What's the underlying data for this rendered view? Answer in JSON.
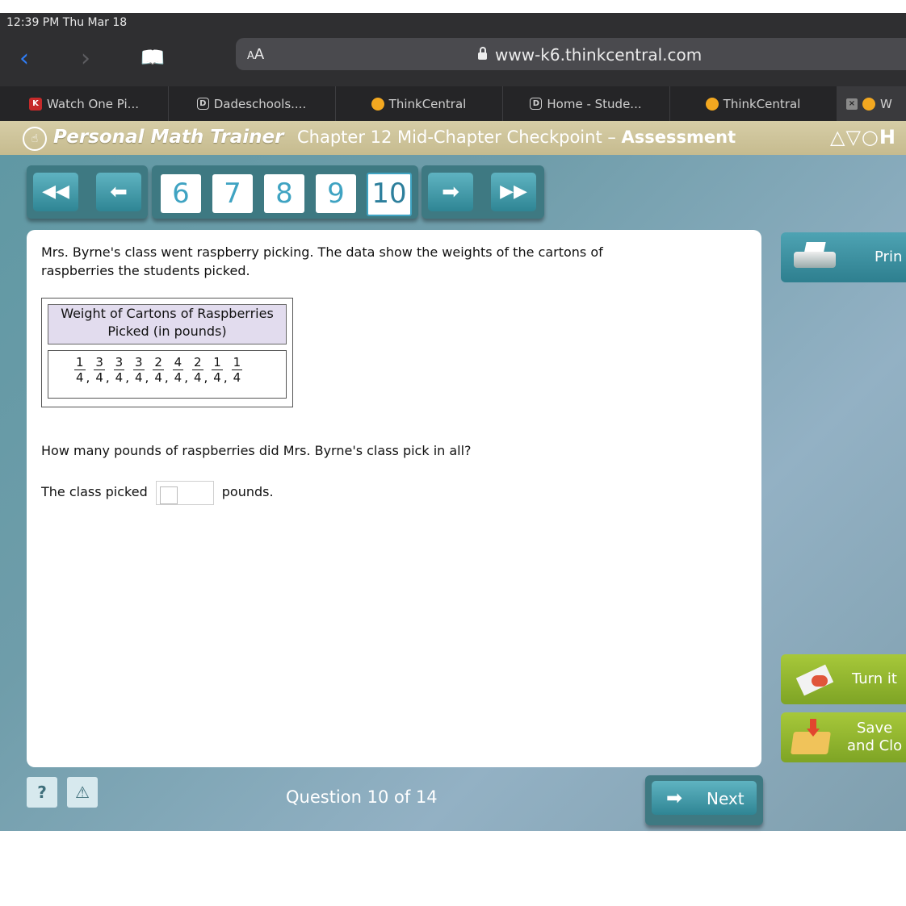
{
  "status_bar": {
    "time": "12:39 PM   Thu Mar 18"
  },
  "browser": {
    "back_glyph": "‹",
    "forward_glyph": "›",
    "bookmarks_glyph": "📖",
    "text_size_small": "A",
    "text_size_large": "A",
    "url": "www-k6.thinkcentral.com",
    "tabs": [
      {
        "label": "Watch One Pi...",
        "icon": "watch-icon",
        "icon_text": "K"
      },
      {
        "label": "Dadeschools....",
        "icon": "d-icon",
        "icon_text": "D"
      },
      {
        "label": "ThinkCentral",
        "icon": "dot-icon",
        "icon_text": ""
      },
      {
        "label": "Home - Stude...",
        "icon": "d-icon",
        "icon_text": "D"
      },
      {
        "label": "ThinkCentral",
        "icon": "dot-icon",
        "icon_text": ""
      },
      {
        "label": "W",
        "icon": "close-icon",
        "icon_text": "×"
      }
    ]
  },
  "header": {
    "app_title": "Personal Math Trainer",
    "chapter": "Chapter 12 Mid-Chapter Checkpoint – ",
    "mode": "Assessment",
    "publisher": "△▽○H"
  },
  "navigation": {
    "first_glyph": "◀◀",
    "prev_glyph": "➡",
    "next_glyph": "➡",
    "last_glyph": "▶▶",
    "pages": [
      "6",
      "7",
      "8",
      "9",
      "10"
    ],
    "current_page": "10"
  },
  "question": {
    "prompt": "Mrs. Byrne's class went raspberry picking. The data show the weights of the cartons of raspberries the students picked.",
    "table_title_line1": "Weight of Cartons of Raspberries",
    "table_title_line2": "Picked (in pounds)",
    "fractions": [
      {
        "num": "1",
        "den": "4"
      },
      {
        "num": "3",
        "den": "4"
      },
      {
        "num": "3",
        "den": "4"
      },
      {
        "num": "3",
        "den": "4"
      },
      {
        "num": "2",
        "den": "4"
      },
      {
        "num": "4",
        "den": "4"
      },
      {
        "num": "2",
        "den": "4"
      },
      {
        "num": "1",
        "den": "4"
      },
      {
        "num": "1",
        "den": "4"
      }
    ],
    "text": "How many pounds of raspberries did Mrs. Byrne's class pick in all?",
    "answer_prefix": "The class picked",
    "answer_suffix": "pounds.",
    "answer_value": ""
  },
  "side_buttons": {
    "print": "Prin",
    "turn_in": "Turn it",
    "save_line1": "Save",
    "save_line2": "and Clo"
  },
  "footer": {
    "help": "?",
    "alert": "⚠",
    "question_label": "Question ",
    "question_current": "10",
    "question_of": " of 14",
    "next_label": "Next",
    "next_glyph": "➡"
  }
}
